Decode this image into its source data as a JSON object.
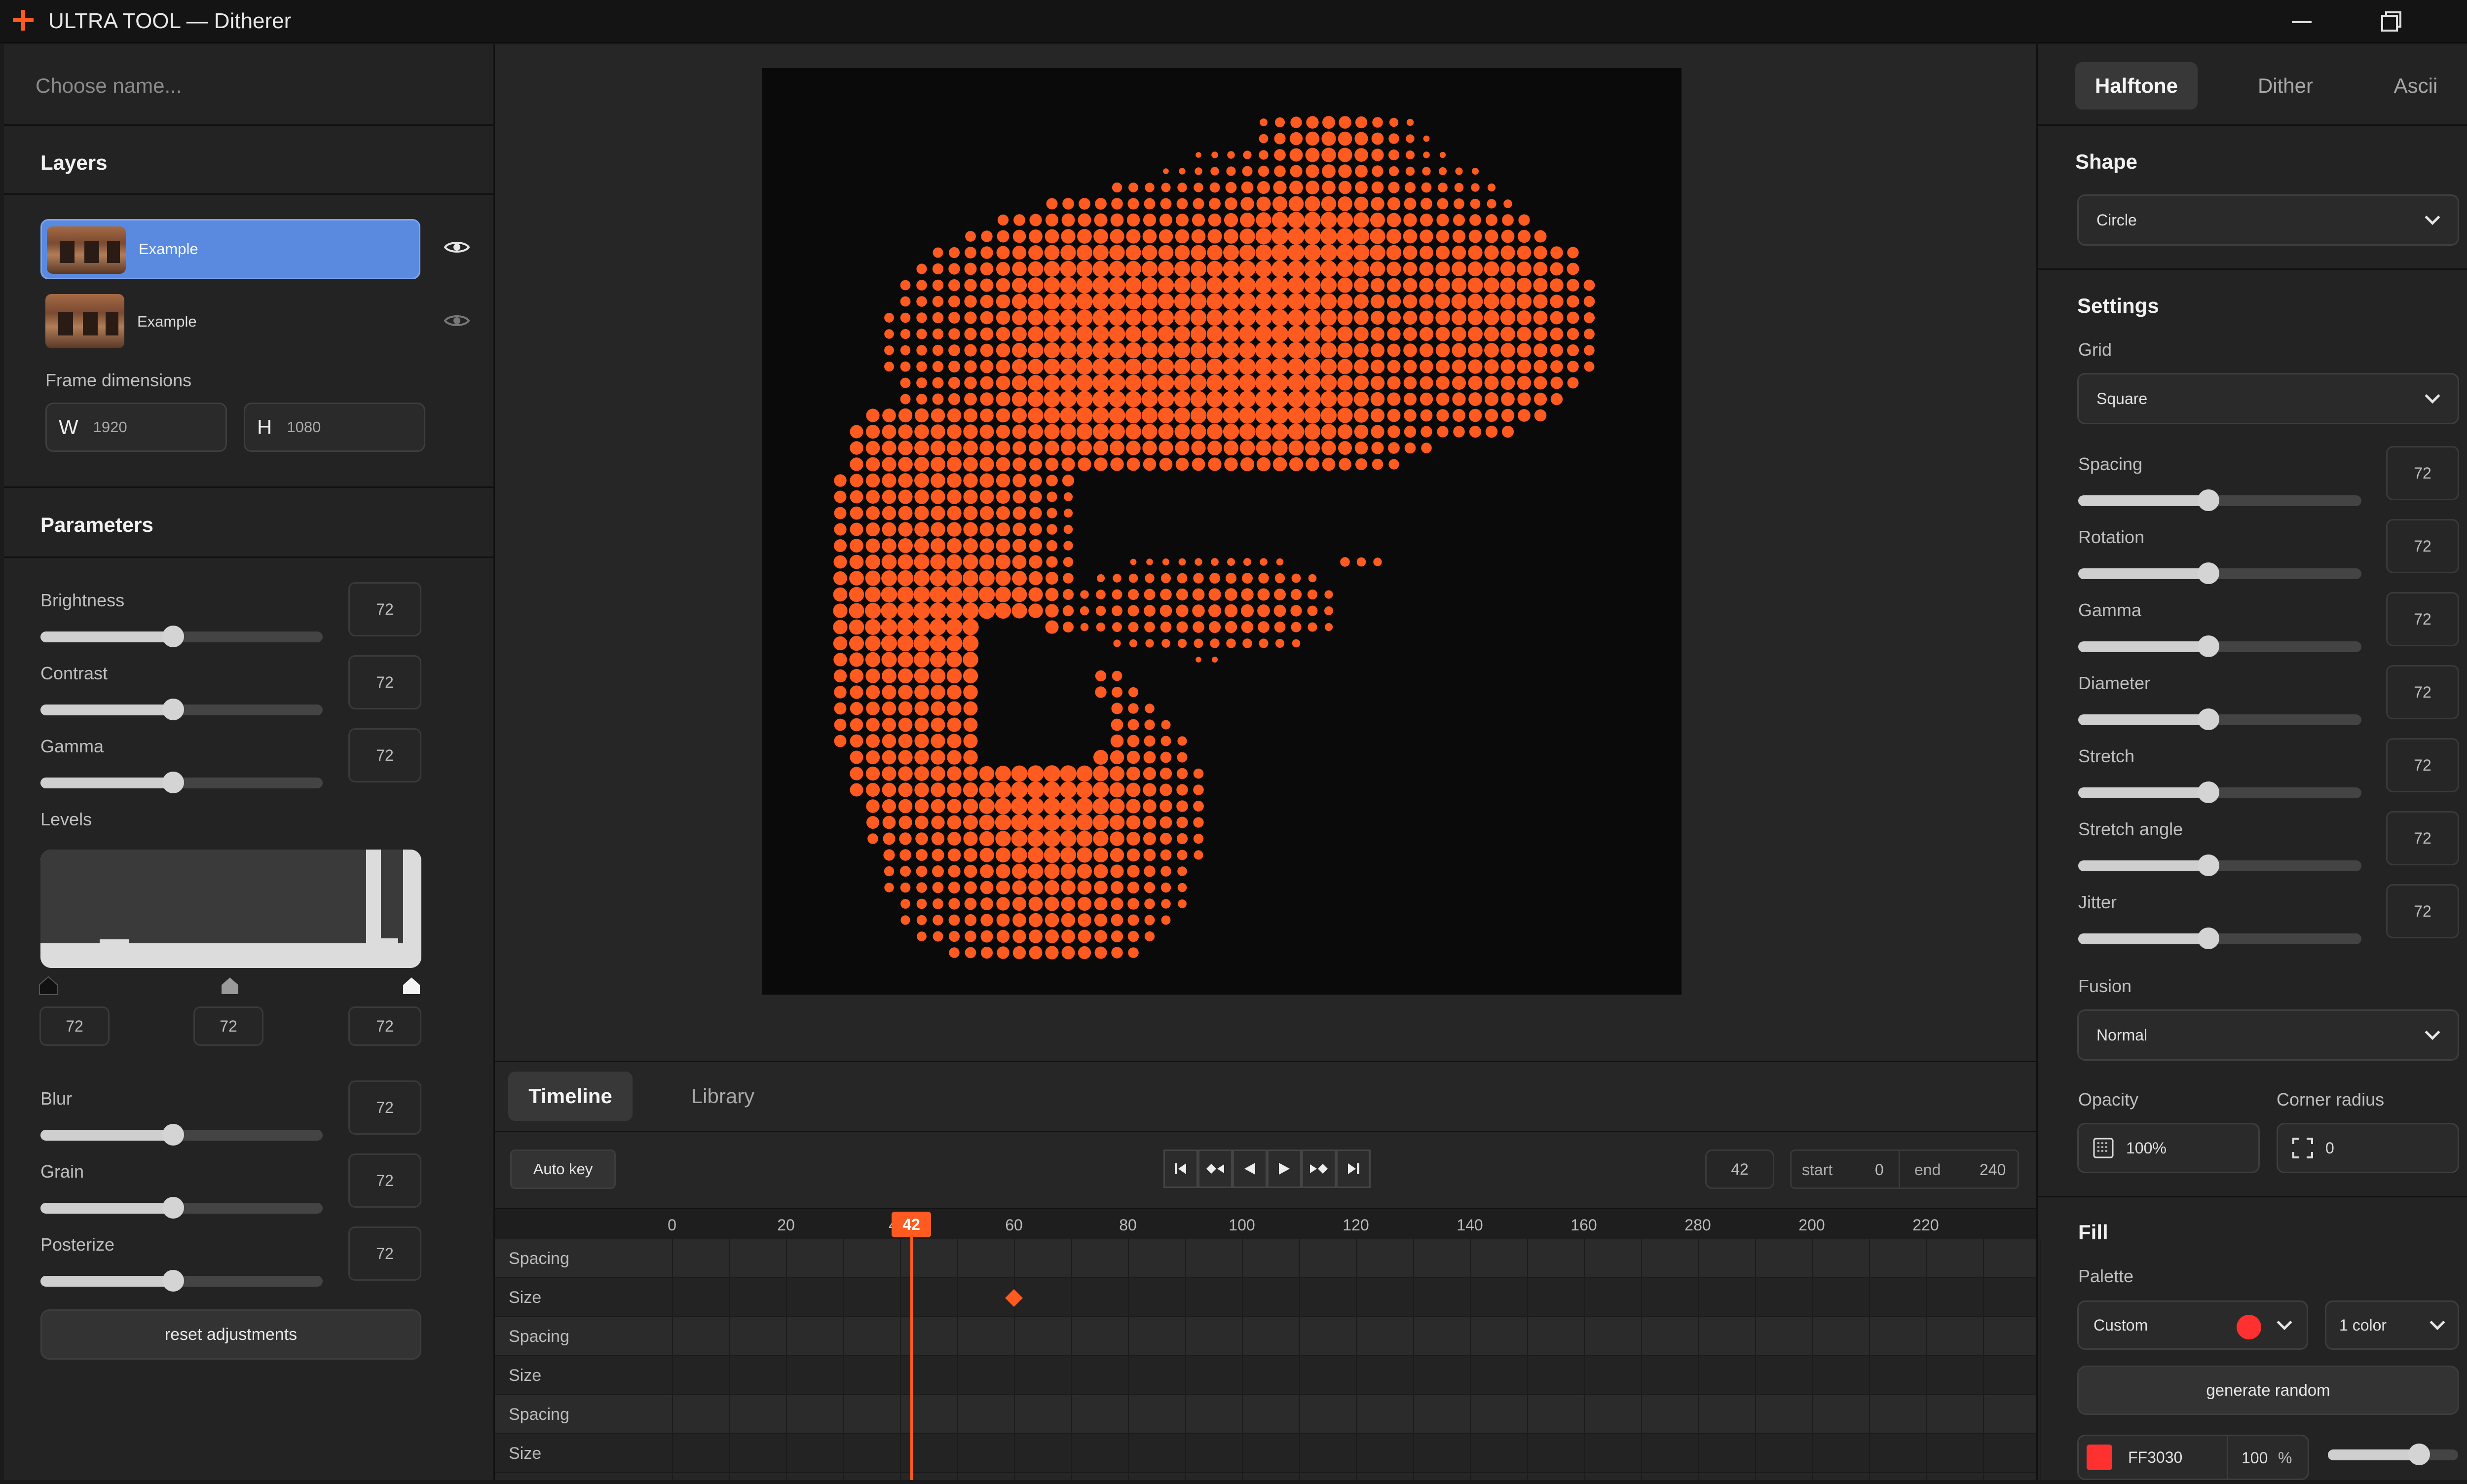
{
  "window": {
    "title": "ULTRA TOOL — Ditherer",
    "accent": "#ff5a1f"
  },
  "left": {
    "name_placeholder": "Choose name...",
    "layers_title": "Layers",
    "layers": [
      {
        "name": "Example",
        "selected": true,
        "visible": true
      },
      {
        "name": "Example",
        "selected": false,
        "visible": false
      }
    ],
    "frame_label": "Frame dimensions",
    "width_label": "W",
    "width": "1920",
    "height_label": "H",
    "height": "1080",
    "params_title": "Parameters",
    "params": [
      {
        "label": "Brightness",
        "value": "72",
        "fraction": 0.47
      },
      {
        "label": "Contrast",
        "value": "72",
        "fraction": 0.47
      },
      {
        "label": "Gamma",
        "value": "72",
        "fraction": 0.47
      }
    ],
    "levels_label": "Levels",
    "levels_values": [
      "72",
      "72",
      "72"
    ],
    "params2": [
      {
        "label": "Blur",
        "value": "72",
        "fraction": 0.47
      },
      {
        "label": "Grain",
        "value": "72",
        "fraction": 0.47
      },
      {
        "label": "Posterize",
        "value": "72",
        "fraction": 0.47
      }
    ],
    "reset_label": "reset adjustments"
  },
  "timeline": {
    "tabs": [
      "Timeline",
      "Library"
    ],
    "autokey": "Auto key",
    "current_frame": "42",
    "start_label": "start",
    "start": "0",
    "end_label": "end",
    "end": "240",
    "playhead": "42",
    "ticks": [
      "0",
      "20",
      "4",
      "60",
      "80",
      "100",
      "120",
      "140",
      "160",
      "280",
      "200",
      "220"
    ],
    "rows": [
      "Spacing",
      "Size",
      "Spacing",
      "Size",
      "Spacing",
      "Size"
    ],
    "keyframe_frame": 60,
    "transport_icons": [
      "skip-start-icon",
      "prev-key-icon",
      "play-reverse-icon",
      "play-icon",
      "next-key-icon",
      "skip-end-icon"
    ]
  },
  "right": {
    "tabs": [
      "Halftone",
      "Dither",
      "Ascii"
    ],
    "shape_title": "Shape",
    "shape": "Circle",
    "settings_title": "Settings",
    "grid_label": "Grid",
    "grid": "Square",
    "sliders": [
      {
        "label": "Spacing",
        "value": "72",
        "fraction": 0.46
      },
      {
        "label": "Rotation",
        "value": "72",
        "fraction": 0.46
      },
      {
        "label": "Gamma",
        "value": "72",
        "fraction": 0.46
      },
      {
        "label": "Diameter",
        "value": "72",
        "fraction": 0.46
      },
      {
        "label": "Stretch",
        "value": "72",
        "fraction": 0.46
      },
      {
        "label": "Stretch angle",
        "value": "72",
        "fraction": 0.46
      },
      {
        "label": "Jitter",
        "value": "72",
        "fraction": 0.46
      }
    ],
    "fusion_label": "Fusion",
    "fusion": "Normal",
    "opacity_label": "Opacity",
    "opacity": "100%",
    "radius_label": "Corner radius",
    "radius": "0",
    "fill_title": "Fill",
    "palette_label": "Palette",
    "palette": "Custom",
    "palette_color": "#ff3030",
    "colors_count": "1 color",
    "generate_label": "generate random",
    "swatch_hex": "FF3030",
    "swatch_alpha": "100",
    "swatch_unit": "%",
    "swatch_fraction": 0.7
  },
  "canvas": {
    "background": "#0a0a0a",
    "dot_color": "#ff5a1f"
  }
}
